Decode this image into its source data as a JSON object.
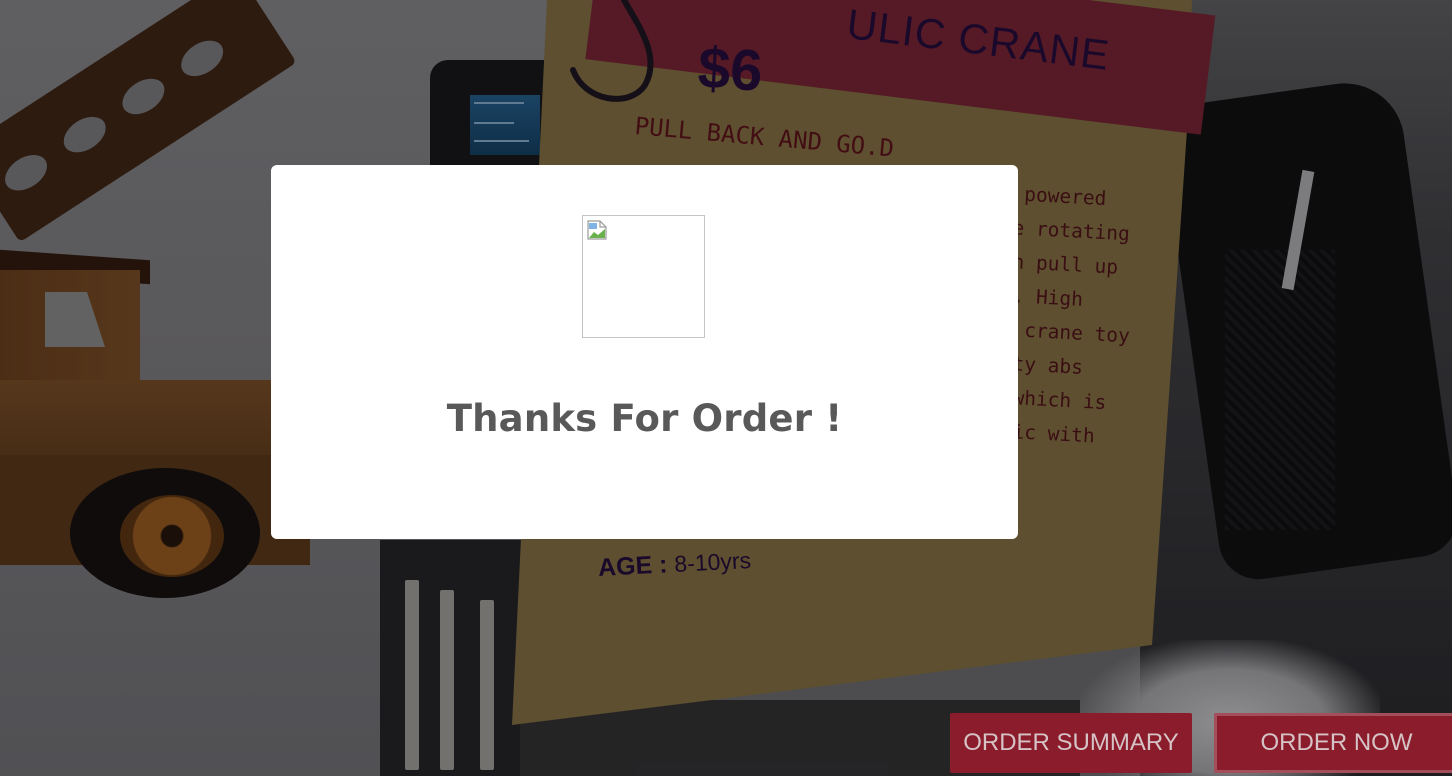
{
  "product": {
    "title": "ULIC CRANE",
    "price": "$6",
    "tagline": "PULL BACK AND GO.D",
    "description_lines": [
      "on powered",
      "ree rotating",
      "can pull up",
      "ht. High",
      "st crane toy",
      "lity abs",
      "l which is",
      "oxic with"
    ],
    "age_label": "AGE :",
    "age_value": "8-10yrs"
  },
  "modal": {
    "image_icon": "broken-image-icon",
    "message": "Thanks For Order !"
  },
  "buttons": {
    "order_summary": "ORDER SUMMARY",
    "order_now": "ORDER NOW"
  },
  "colors": {
    "button_bg": "#8b1c2b",
    "card_bg": "#97804d",
    "banner": "#8c2a3e",
    "modal_bg": "#ffffff",
    "modal_text": "#595959"
  }
}
